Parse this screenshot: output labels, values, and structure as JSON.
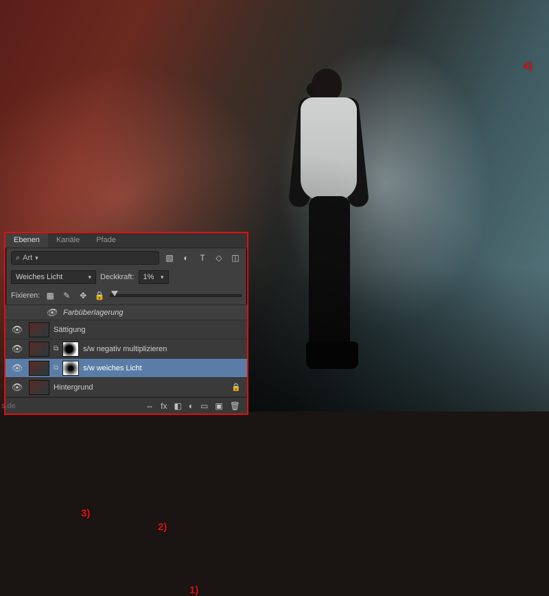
{
  "annotations": {
    "a1": "1)",
    "a2": "2)",
    "a3": "3)",
    "a4": "4)"
  },
  "watermark": "s.de",
  "panel": {
    "tabs": {
      "layers": "Ebenen",
      "channels": "Kanäle",
      "paths": "Pfade"
    },
    "search": {
      "glyph": "⌕",
      "placeholder": "Art"
    },
    "filterIcons": {
      "image": "image-filter-icon",
      "adjust": "adjustment-filter-icon",
      "type": "type-filter-icon",
      "shape": "shape-filter-icon",
      "smart": "smart-filter-icon"
    },
    "blendMode": "Weiches Licht",
    "opacityLabel": "Deckkraft:",
    "opacityValue": "1%",
    "lockLabel": "Fixieren:",
    "effects": {
      "colorOverlay": "Farbüberlagerung"
    },
    "layers": [
      {
        "name": "Sättigung"
      },
      {
        "name": "s/w negativ multiplizieren"
      },
      {
        "name": "s/w weiches Licht"
      },
      {
        "name": "Hintergrund"
      }
    ],
    "footerIcons": {
      "link": "⌘",
      "fx": "fx",
      "mask": "◧",
      "adj": "◐",
      "group": "▭",
      "new": "▣",
      "trash": "🗑"
    }
  }
}
